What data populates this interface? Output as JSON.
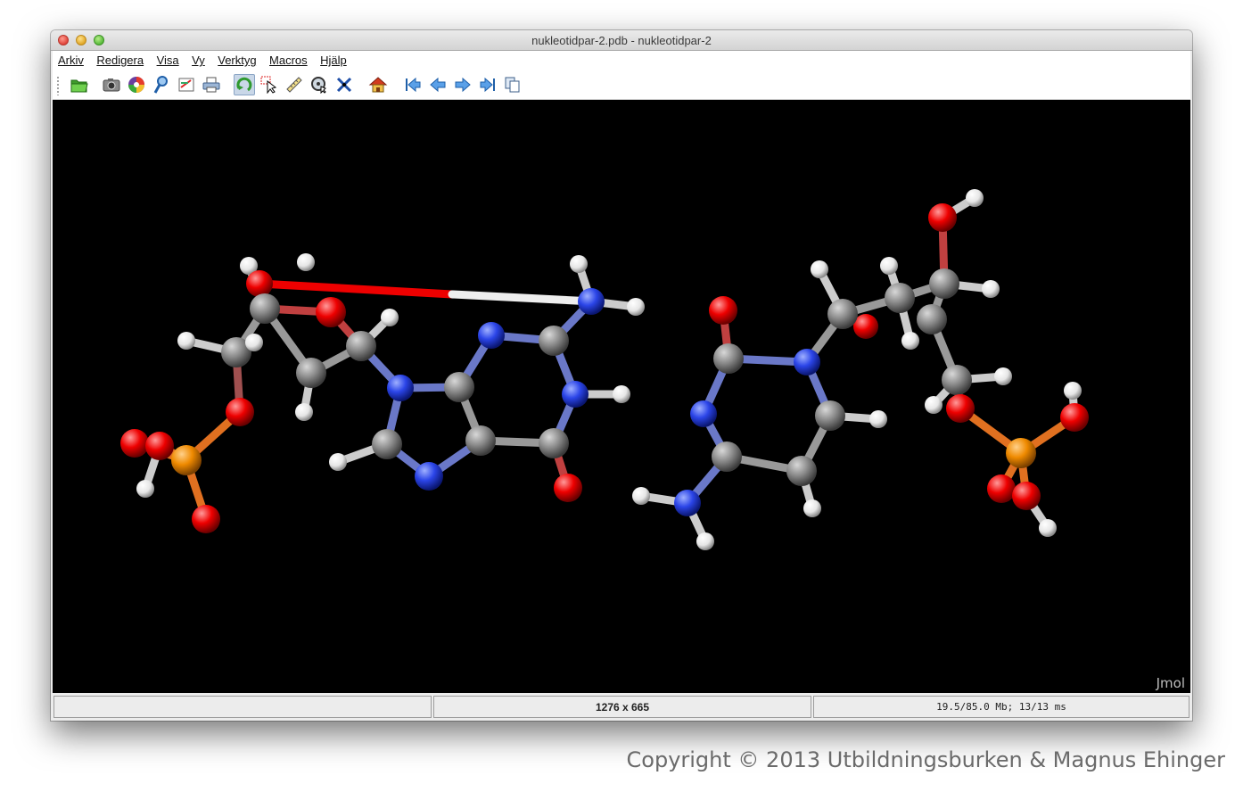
{
  "window": {
    "title": "nukleotidpar-2.pdb - nukleotidpar-2"
  },
  "menu": {
    "items": [
      "Arkiv",
      "Redigera",
      "Visa",
      "Vy",
      "Verktyg",
      "Macros",
      "Hjälp"
    ]
  },
  "toolbar": {
    "buttons": [
      {
        "name": "open-file-icon"
      },
      {
        "name": "screenshot-icon"
      },
      {
        "name": "color-palette-icon"
      },
      {
        "name": "inspect-icon"
      },
      {
        "name": "edit-icon"
      },
      {
        "name": "print-icon"
      },
      {
        "name": "rotate-icon",
        "active": true
      },
      {
        "name": "select-pointer-icon"
      },
      {
        "name": "measure-ruler-icon"
      },
      {
        "name": "pick-center-icon"
      },
      {
        "name": "distance-icon"
      },
      {
        "name": "home-icon"
      },
      {
        "name": "first-frame-icon"
      },
      {
        "name": "previous-frame-icon"
      },
      {
        "name": "next-frame-icon"
      },
      {
        "name": "last-frame-icon"
      },
      {
        "name": "copy-icon"
      }
    ]
  },
  "viewer": {
    "watermark": "Jmol",
    "colors": {
      "background": "#000000",
      "carbon": "#8c8c8c",
      "nitrogen": "#2b45e8",
      "oxygen": "#ee0000",
      "hydrogen": "#f2f2f2",
      "phosphorus": "#ef8a00"
    }
  },
  "status": {
    "left": "",
    "size": "1276 x 665",
    "memory": "19.5/85.0 Mb;  13/13 ms"
  },
  "copyright": "Copyright © 2013 Utbildningsburken & Magnus Ehinger"
}
